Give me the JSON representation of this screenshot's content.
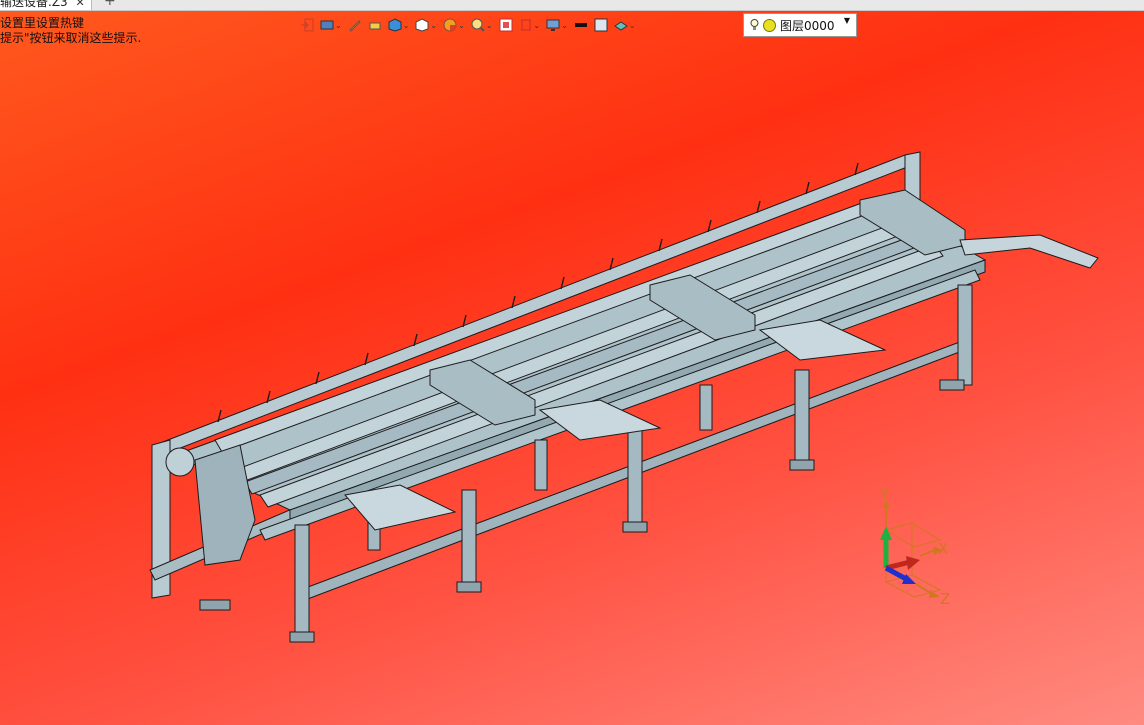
{
  "tab": {
    "title": "输送设备.Z3",
    "close": "✕",
    "new": "+"
  },
  "hints": {
    "line1": "设置里设置热键",
    "line2": "提示\"按钮来取消这些提示."
  },
  "toolbar": {
    "icons": [
      "exit-sketch-icon",
      "view-style-icon",
      "pencil-icon",
      "eraser-icon",
      "blue-cube-icon",
      "white-cube-icon",
      "pie-section-icon",
      "zoom-icon",
      "zoom-fit-icon",
      "section-plane-icon",
      "display-icon",
      "line-color-icon",
      "face-color-icon",
      "material-icon"
    ]
  },
  "layer_selector": {
    "value": "图层0000"
  },
  "axes": {
    "x": "X",
    "y": "Y",
    "z": "Z"
  },
  "colors": {
    "accent": "#ff3012",
    "model_fill": "#b6c8d0",
    "model_edge": "#1a1a1a",
    "x_axis": "#c0281c",
    "y_axis": "#20b040",
    "z_axis": "#2030d0"
  }
}
